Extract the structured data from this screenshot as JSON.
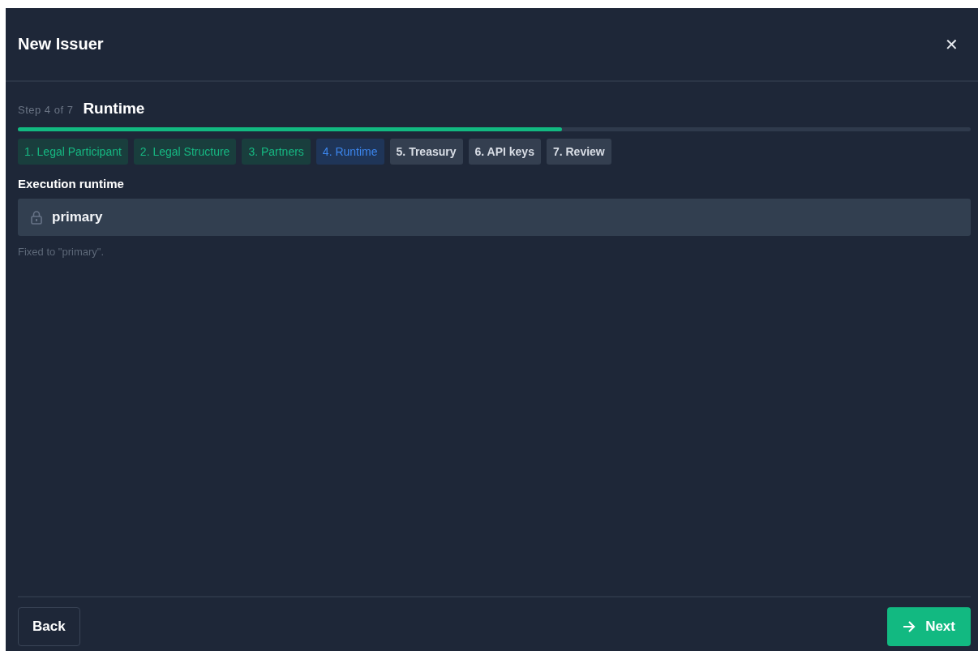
{
  "dialog": {
    "title": "New Issuer",
    "close": "✕"
  },
  "wizard": {
    "step_counter": "Step 4 of 7",
    "step_title": "Runtime",
    "progress": {
      "level": 0.571
    },
    "steps": [
      {
        "label": "1. Legal Participant",
        "completed": true,
        "selected": false
      },
      {
        "label": "2. Legal Structure",
        "completed": true,
        "selected": false
      },
      {
        "label": "3. Partners",
        "completed": true,
        "selected": false
      },
      {
        "label": "4. Runtime",
        "completed": false,
        "selected": true
      },
      {
        "label": "5. Treasury",
        "completed": false,
        "selected": false
      },
      {
        "label": "6. API keys",
        "completed": false,
        "selected": false
      },
      {
        "label": "7. Review",
        "completed": false,
        "selected": false
      }
    ]
  },
  "field": {
    "label": "Execution runtime",
    "value": "primary",
    "locked": true,
    "hint": "Fixed to \"primary\"."
  },
  "footer": {
    "back": "Back",
    "next": "Next"
  }
}
